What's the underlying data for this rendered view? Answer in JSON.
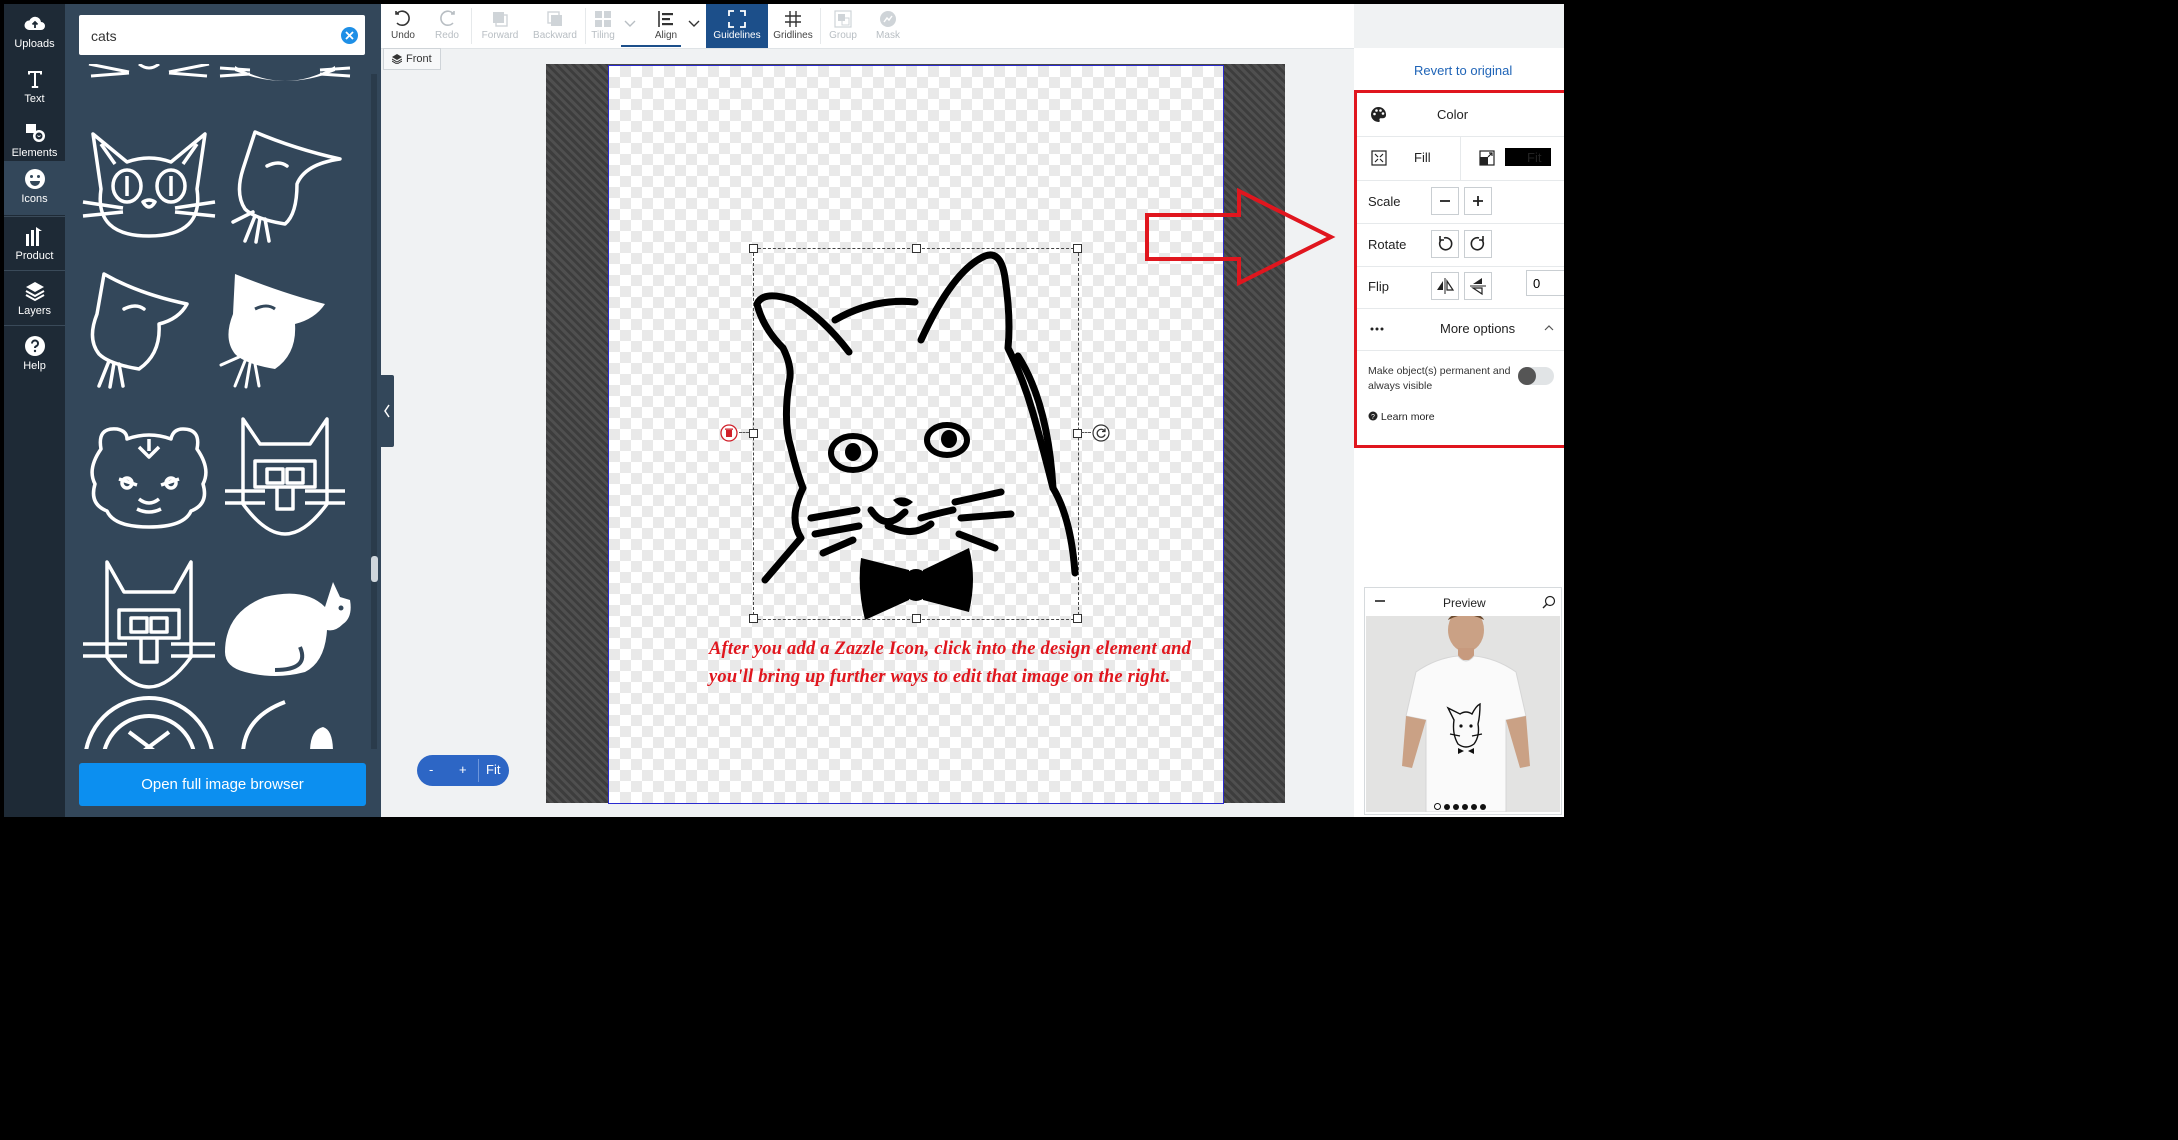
{
  "rail": {
    "items": [
      {
        "label": "Uploads",
        "icon": "cloud-upload-icon"
      },
      {
        "label": "Text",
        "icon": "text-icon"
      },
      {
        "label": "Elements",
        "icon": "elements-icon"
      },
      {
        "label": "Icons",
        "icon": "smiley-icon",
        "active": true
      },
      {
        "label": "Product",
        "icon": "product-icon"
      },
      {
        "label": "Layers",
        "icon": "layers-icon"
      },
      {
        "label": "Help",
        "icon": "help-icon"
      }
    ]
  },
  "panel": {
    "search_value": "cats",
    "open_browser_label": "Open full image browser",
    "icon_results": [
      "cat-face-round-eyes",
      "cat-profile-outline",
      "cat-profile-outline-2",
      "cat-profile-solid",
      "cat-face-angry",
      "cat-totem",
      "cat-totem-2",
      "cat-sitting-solid"
    ]
  },
  "toolbar": {
    "undo": "Undo",
    "redo": "Redo",
    "forward": "Forward",
    "backward": "Backward",
    "tiling": "Tiling",
    "align": "Align",
    "guidelines": "Guidelines",
    "gridlines": "Gridlines",
    "group": "Group",
    "mask": "Mask"
  },
  "canvas": {
    "side_label": "Front",
    "caption": "After you add a Zazzle Icon, click into the design element and you'll bring up further ways to edit that image on the right.",
    "zoom": {
      "minus": "-",
      "plus": "+",
      "fit": "Fit"
    }
  },
  "properties": {
    "revert_label": "Revert to original",
    "color_label": "Color",
    "color_value": "#000000",
    "fill_label": "Fill",
    "fit_label": "Fit",
    "scale_label": "Scale",
    "rotate_label": "Rotate",
    "rotate_value": "0",
    "flip_label": "Flip",
    "more_label": "More options",
    "permanent_label": "Make object(s) permanent and always visible",
    "learn_more": "Learn more"
  },
  "preview": {
    "title": "Preview",
    "pages": 6,
    "current_page": 1
  },
  "colors": {
    "accent": "#1c4f8a",
    "link": "#1f64b7",
    "annotation_red": "#e0161e",
    "panel_dark": "#33475a"
  }
}
